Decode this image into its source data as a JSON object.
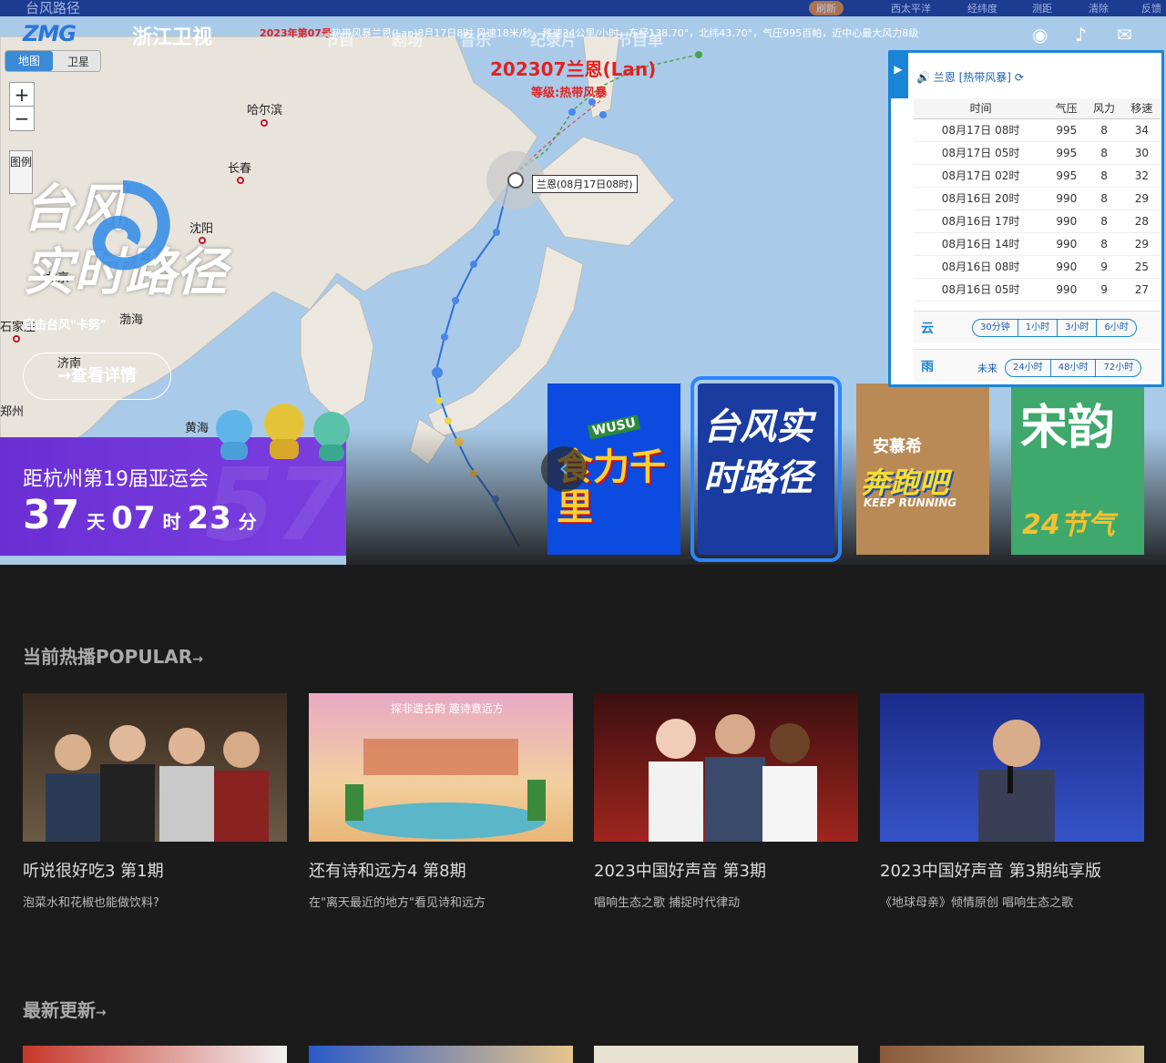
{
  "topbar": {
    "title": "台风路径",
    "tools": [
      "刷新",
      "西太平洋",
      "经纬度",
      "测距",
      "清除",
      "反馈"
    ]
  },
  "ticker": {
    "prefix": "2023年第07号",
    "text": "热带风暴兰恩(Lan)8月17日8时 风速18米/秒，移速34公里/小时，东经138.70°，北纬43.70°，气压995百帕，近中心最大风力8级"
  },
  "header": {
    "logo_zmg": "ZMG",
    "logo_zjtv": "浙江卫视",
    "nav": [
      "节目",
      "剧场",
      "音乐",
      "纪录片",
      "节目单"
    ]
  },
  "map": {
    "toggle": [
      "地图",
      "卫星"
    ],
    "zoom_in": "+",
    "zoom_out": "−",
    "legend": "图例",
    "cities": [
      "哈尔滨",
      "长春",
      "沈阳",
      "北京",
      "石家庄",
      "济南",
      "渤海",
      "黄海",
      "郑州"
    ],
    "typhoon_name": "202307兰恩(Lan)",
    "typhoon_level": "等级:热带风暴",
    "typhoon_label": "兰恩(08月17日08时)"
  },
  "hero": {
    "title_line1": "台风",
    "title_line2": "实时路径",
    "subtitle": "直击台风\"卡努\"",
    "button": "→查看详情"
  },
  "asian_games": {
    "label": "距杭州第19届亚运会",
    "days": "37",
    "days_unit": "天",
    "hours": "07",
    "hours_unit": "时",
    "minutes": "23",
    "minutes_unit": "分",
    "watermark": "57"
  },
  "panel": {
    "name": "兰恩",
    "type": "[热带风暴]",
    "columns": [
      "时间",
      "气压",
      "风力",
      "移速"
    ],
    "rows": [
      {
        "time": "08月17日 08时",
        "pressure": "995",
        "wind": "8",
        "speed": "34"
      },
      {
        "time": "08月17日 05时",
        "pressure": "995",
        "wind": "8",
        "speed": "30"
      },
      {
        "time": "08月17日 02时",
        "pressure": "995",
        "wind": "8",
        "speed": "32"
      },
      {
        "time": "08月16日 20时",
        "pressure": "990",
        "wind": "8",
        "speed": "29"
      },
      {
        "time": "08月16日 17时",
        "pressure": "990",
        "wind": "8",
        "speed": "28"
      },
      {
        "time": "08月16日 14时",
        "pressure": "990",
        "wind": "8",
        "speed": "29"
      },
      {
        "time": "08月16日 08时",
        "pressure": "990",
        "wind": "9",
        "speed": "25"
      },
      {
        "time": "08月16日 05时",
        "pressure": "990",
        "wind": "9",
        "speed": "27"
      }
    ],
    "cloud_icon": "云",
    "cloud_options": [
      "30分钟",
      "1小时",
      "3小时",
      "6小时"
    ],
    "rain_icon": "雨",
    "rain_label": "未来",
    "rain_options": [
      "24小时",
      "48小时",
      "72小时"
    ]
  },
  "carousel": {
    "slides": [
      {
        "title": "食力千里",
        "badge": "WUSU"
      },
      {
        "title": "台风实时路径"
      },
      {
        "title": "奔跑吧",
        "badge": "安慕希",
        "sub": "KEEP RUNNING"
      },
      {
        "title": "宋韵",
        "sub": "24节气"
      }
    ]
  },
  "popular": {
    "title": "当前热播POPULAR",
    "cards": [
      {
        "title": "听说很好吃3 第1期",
        "sub": "泡菜水和花椒也能做饮料?"
      },
      {
        "title": "还有诗和远方4 第8期",
        "sub": "在\"离天最近的地方\"看见诗和远方",
        "banner": "探非遗古韵 趣诗意远方"
      },
      {
        "title": "2023中国好声音 第3期",
        "sub": "唱响生态之歌 捕捉时代律动"
      },
      {
        "title": "2023中国好声音 第3期纯享版",
        "sub": "《地球母亲》倾情原创 唱响生态之歌"
      }
    ]
  },
  "latest": {
    "title": "最新更新"
  },
  "colors": {
    "accent": "#2a86ff",
    "typhoon": "#e12222",
    "asian_purple": "#6a2fd4"
  }
}
